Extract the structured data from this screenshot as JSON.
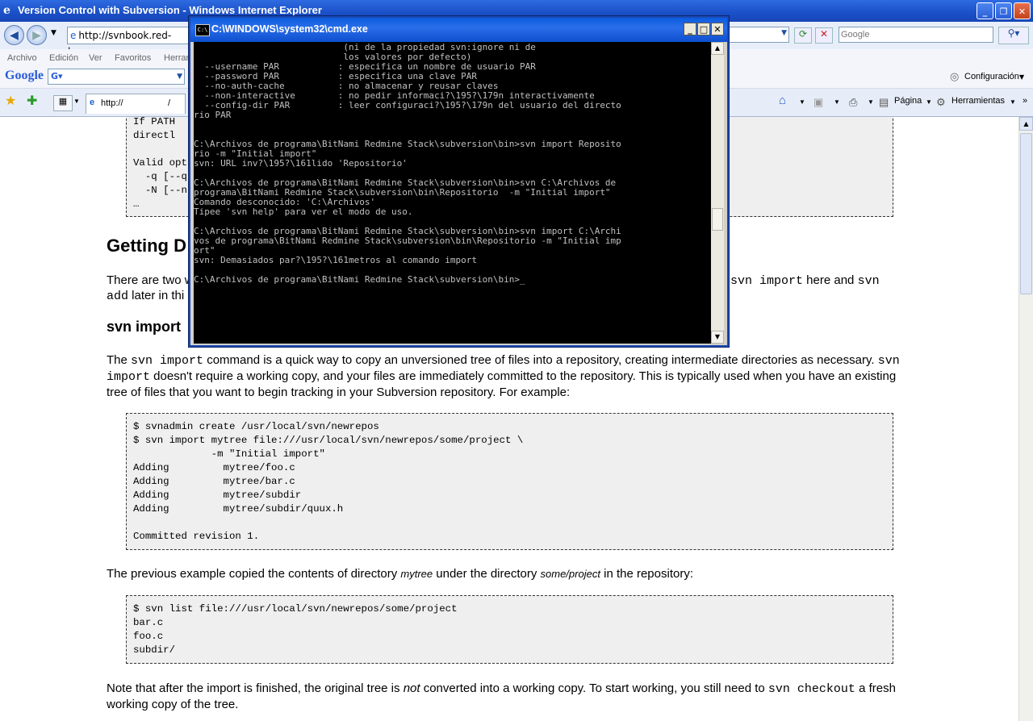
{
  "ie": {
    "title": "Version Control with Subversion - Windows Internet Explorer",
    "address": "http://svnbook.red-bean.c",
    "search_placeholder": "Google",
    "menu": [
      "Archivo",
      "Edición",
      "Ver",
      "Favoritos",
      "Herram"
    ],
    "google_label": "Google",
    "google_box": "G▾",
    "config_label": "Configuración",
    "tab_url": "http://",
    "tab_url_suffix": "/",
    "page_label": "Página",
    "tools_label": "Herramientas"
  },
  "cmd": {
    "title": "C:\\WINDOWS\\system32\\cmd.exe",
    "lines": [
      "                            (ni de la propiedad svn:ignore ni de",
      "                            los valores por defecto)",
      "  --username PAR           : especifica un nombre de usuario PAR",
      "  --password PAR           : especifica una clave PAR",
      "  --no-auth-cache          : no almacenar y reusar claves",
      "  --non-interactive        : no pedir informaci?\\195?\\179n interactivamente",
      "  --config-dir PAR         : leer configuraci?\\195?\\179n del usuario del directo",
      "rio PAR",
      "",
      "",
      "C:\\Archivos de programa\\BitNami Redmine Stack\\subversion\\bin>svn import Reposito",
      "rio -m \"Initial import\"",
      "svn: URL inv?\\195?\\161lido 'Repositorio'",
      "",
      "C:\\Archivos de programa\\BitNami Redmine Stack\\subversion\\bin>svn C:\\Archivos de",
      "programa\\BitNami Redmine Stack\\subversion\\bin\\Repositorio  -m \"Initial import\"",
      "Comando desconocido: 'C:\\Archivos'",
      "Tipee 'svn help' para ver el modo de uso.",
      "",
      "C:\\Archivos de programa\\BitNami Redmine Stack\\subversion\\bin>svn import C:\\Archi",
      "vos de programa\\BitNami Redmine Stack\\subversion\\bin\\Repositorio -m \"Initial imp",
      "ort\"",
      "svn: Demasiados par?\\195?\\161metros al comando import",
      "",
      "C:\\Archivos de programa\\BitNami Redmine Stack\\subversion\\bin>_"
    ]
  },
  "page": {
    "top_block": "If PATH\ndirectl\n\nValid opt\n  -q [--q\n  -N [--n\n…",
    "heading_getting": "Getting D",
    "para1_a": "There are two w",
    "para1_code1": "svn import",
    "para1_b": " here and ",
    "para1_code2": "svn",
    "para1_code3": "add",
    "para1_c": " later in thi",
    "heading_import": "svn import",
    "para2_a": "The ",
    "para2_code1": "svn import",
    "para2_b": " command is a quick way to copy an unversioned tree of files into a repository, creating intermediate directories as necessary. ",
    "para2_code2": "svn import",
    "para2_c": " doesn't require a working copy, and your files are immediately committed to the repository. This is typically used when you have an existing tree of files that you want to begin tracking in your Subversion repository. For example:",
    "code1": "$ svnadmin create /usr/local/svn/newrepos\n$ svn import mytree file:///usr/local/svn/newrepos/some/project \\\n             -m \"Initial import\"\nAdding         mytree/foo.c\nAdding         mytree/bar.c\nAdding         mytree/subdir\nAdding         mytree/subdir/quux.h\n\nCommitted revision 1.",
    "para3_a": "The previous example copied the contents of directory ",
    "para3_em1": "mytree",
    "para3_b": " under the directory ",
    "para3_em2": "some/project",
    "para3_c": " in the repository:",
    "code2": "$ svn list file:///usr/local/svn/newrepos/some/project\nbar.c\nfoo.c\nsubdir/",
    "para4_a": "Note that after the import is finished, the original tree is ",
    "para4_em": "not",
    "para4_b": " converted into a working copy. To start working, you still need to ",
    "para4_code": "svn checkout",
    "para4_c": " a fresh working copy of the tree."
  }
}
